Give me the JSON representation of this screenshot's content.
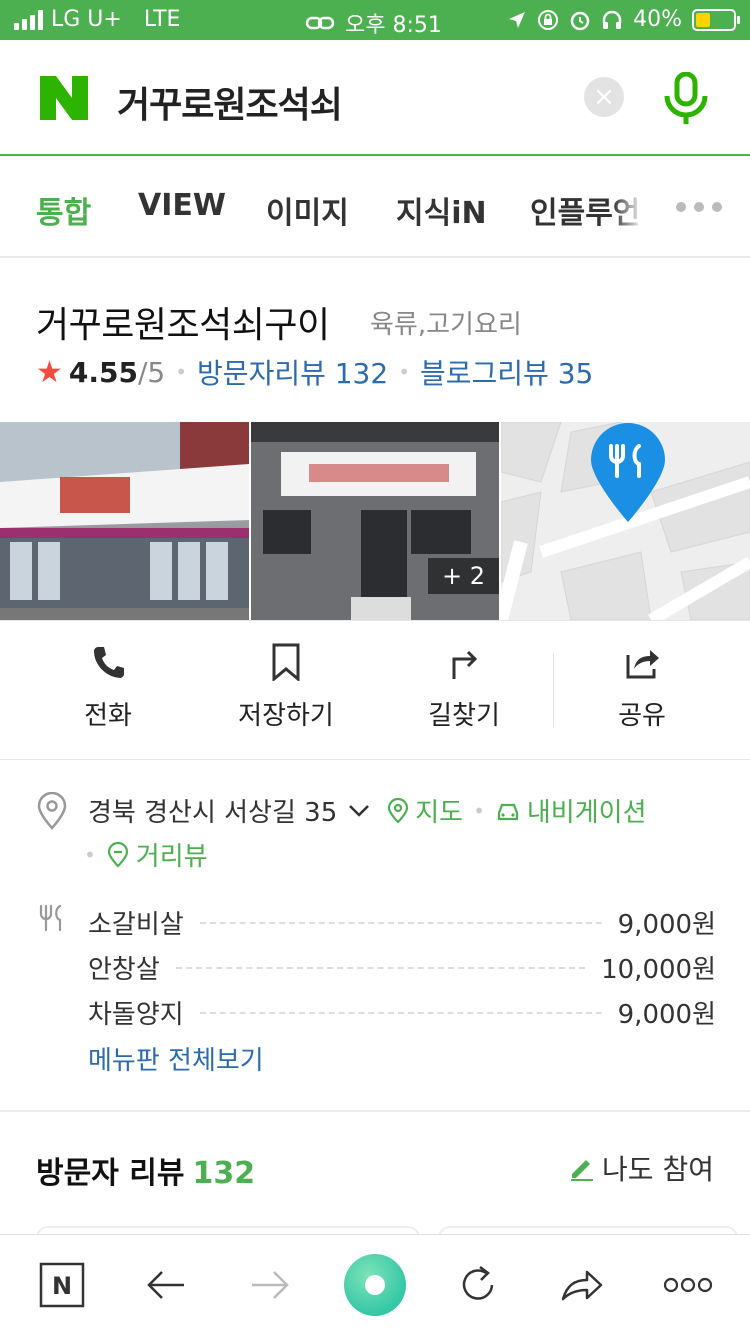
{
  "status_bar": {
    "carrier": "LG U+",
    "network": "LTE",
    "time": "오후 8:51",
    "battery": "40%",
    "battery_level": 0.4
  },
  "search": {
    "query": "거꾸로원조석쇠",
    "clear_icon": "×",
    "logo": "N"
  },
  "tabs": [
    {
      "label": "통합",
      "active": true
    },
    {
      "label": "VIEW"
    },
    {
      "label": "이미지"
    },
    {
      "label": "지식iN"
    },
    {
      "label": "인플루언"
    }
  ],
  "place": {
    "name": "거꾸로원조석쇠구이",
    "category": "육류,고기요리",
    "rating": "4.55",
    "rating_max": "/5",
    "visitor_reviews": "방문자리뷰 132",
    "blog_reviews": "블로그리뷰 35"
  },
  "photos": {
    "more_count": "+ 2"
  },
  "actions": [
    {
      "label": "전화",
      "icon": "phone-icon"
    },
    {
      "label": "저장하기",
      "icon": "bookmark-icon"
    },
    {
      "label": "길찾기",
      "icon": "directions-icon"
    },
    {
      "label": "공유",
      "icon": "share-icon"
    }
  ],
  "info": {
    "address": "경북 경산시 서상길 35",
    "map_link": "지도",
    "navigation_link": "내비게이션",
    "streetview_link": "거리뷰"
  },
  "menu": {
    "items": [
      {
        "name": "소갈비살",
        "price": "9,000원"
      },
      {
        "name": "안창살",
        "price": "10,000원"
      },
      {
        "name": "차돌양지",
        "price": "9,000원"
      }
    ],
    "view_all": "메뉴판 전체보기"
  },
  "reviews": {
    "title": "방문자 리뷰",
    "count": "132",
    "participate": "나도 참여"
  },
  "colors": {
    "brand_green": "#4caf50",
    "link_blue": "#2d6bb0",
    "star_red": "#f44b3e"
  }
}
